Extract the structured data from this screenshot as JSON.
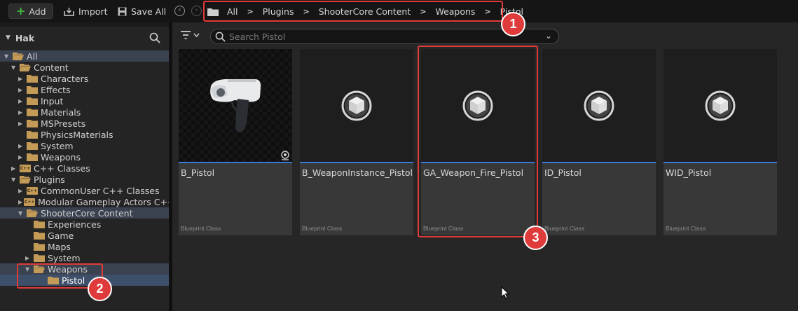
{
  "toolbar": {
    "add_label": "Add",
    "import_label": "Import",
    "save_all_label": "Save All"
  },
  "breadcrumb": {
    "items": [
      "All",
      "Plugins",
      "ShooterCore Content",
      "Weapons",
      "Pistol"
    ]
  },
  "markers": [
    "1",
    "2",
    "3"
  ],
  "left_panel": {
    "title": "Hak",
    "tree": [
      {
        "label": "All",
        "depth": 0,
        "expanded": true
      },
      {
        "label": "Content",
        "depth": 1,
        "expanded": true
      },
      {
        "label": "Characters",
        "depth": 2,
        "expanded": false
      },
      {
        "label": "Effects",
        "depth": 2,
        "expanded": false
      },
      {
        "label": "Input",
        "depth": 2,
        "expanded": false
      },
      {
        "label": "Materials",
        "depth": 2,
        "expanded": false
      },
      {
        "label": "MSPresets",
        "depth": 2,
        "expanded": false
      },
      {
        "label": "PhysicsMaterials",
        "depth": 2,
        "expanded": null
      },
      {
        "label": "System",
        "depth": 2,
        "expanded": false
      },
      {
        "label": "Weapons",
        "depth": 2,
        "expanded": false
      },
      {
        "label": "C++ Classes",
        "depth": 1,
        "expanded": false
      },
      {
        "label": "Plugins",
        "depth": 1,
        "expanded": true
      },
      {
        "label": "CommonUser C++ Classes",
        "depth": 2,
        "expanded": false
      },
      {
        "label": "Modular Gameplay Actors C++ C",
        "depth": 2,
        "expanded": false
      },
      {
        "label": "ShooterCore Content",
        "depth": 2,
        "expanded": true
      },
      {
        "label": "Experiences",
        "depth": 3,
        "expanded": null
      },
      {
        "label": "Game",
        "depth": 3,
        "expanded": null
      },
      {
        "label": "Maps",
        "depth": 3,
        "expanded": null
      },
      {
        "label": "System",
        "depth": 3,
        "expanded": false
      },
      {
        "label": "Weapons",
        "depth": 3,
        "expanded": true
      },
      {
        "label": "Pistol",
        "depth": 4,
        "expanded": null
      }
    ]
  },
  "search": {
    "placeholder": "Search Pistol"
  },
  "assets": [
    {
      "name": "B_Pistol",
      "type": "Blueprint Class"
    },
    {
      "name": "B_WeaponInstance_Pistol",
      "type": "Blueprint Class"
    },
    {
      "name": "GA_Weapon_Fire_Pistol",
      "type": "Blueprint Class"
    },
    {
      "name": "ID_Pistol",
      "type": "Blueprint Class"
    },
    {
      "name": "WID_Pistol",
      "type": "Blueprint Class"
    }
  ],
  "colors": {
    "accent_blue": "#3d7ad6",
    "highlight_red": "#e03b3b",
    "add_green": "#3fbb3f",
    "folder": "#c49a57"
  }
}
